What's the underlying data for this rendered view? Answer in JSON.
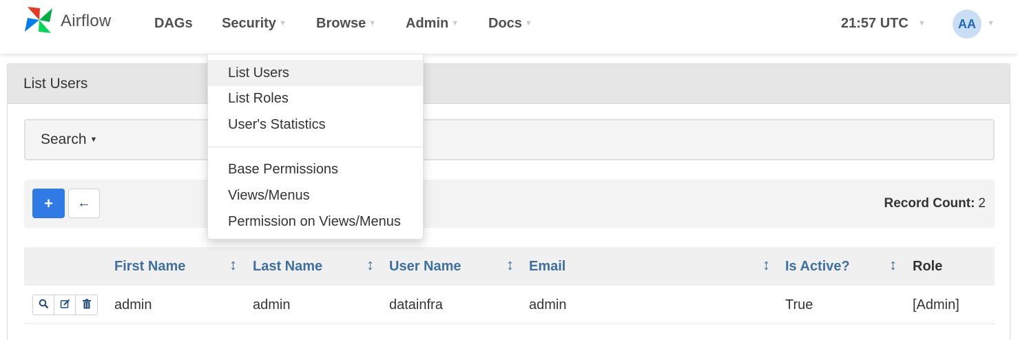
{
  "brand": {
    "name": "Airflow"
  },
  "nav": {
    "dags": "DAGs",
    "security": "Security",
    "browse": "Browse",
    "admin": "Admin",
    "docs": "Docs",
    "clock": "21:57 UTC",
    "avatar": "AA"
  },
  "security_menu": {
    "items": [
      "List Users",
      "List Roles",
      "User's Statistics",
      "Base Permissions",
      "Views/Menus",
      "Permission on Views/Menus"
    ]
  },
  "panel": {
    "title": "List Users",
    "search_label": "Search",
    "record_count_label": "Record Count:",
    "record_count": "2"
  },
  "table": {
    "columns": [
      "First Name",
      "Last Name",
      "User Name",
      "Email",
      "Is Active?",
      "Role"
    ],
    "rows": [
      {
        "first_name": "admin",
        "last_name": "admin",
        "user_name": "datainfra",
        "email": "admin",
        "is_active": "True",
        "role": "[Admin]"
      }
    ]
  },
  "colors": {
    "primary": "#2f7ae5",
    "link": "#3d6fa0",
    "avatar_bg": "#c9def5"
  }
}
